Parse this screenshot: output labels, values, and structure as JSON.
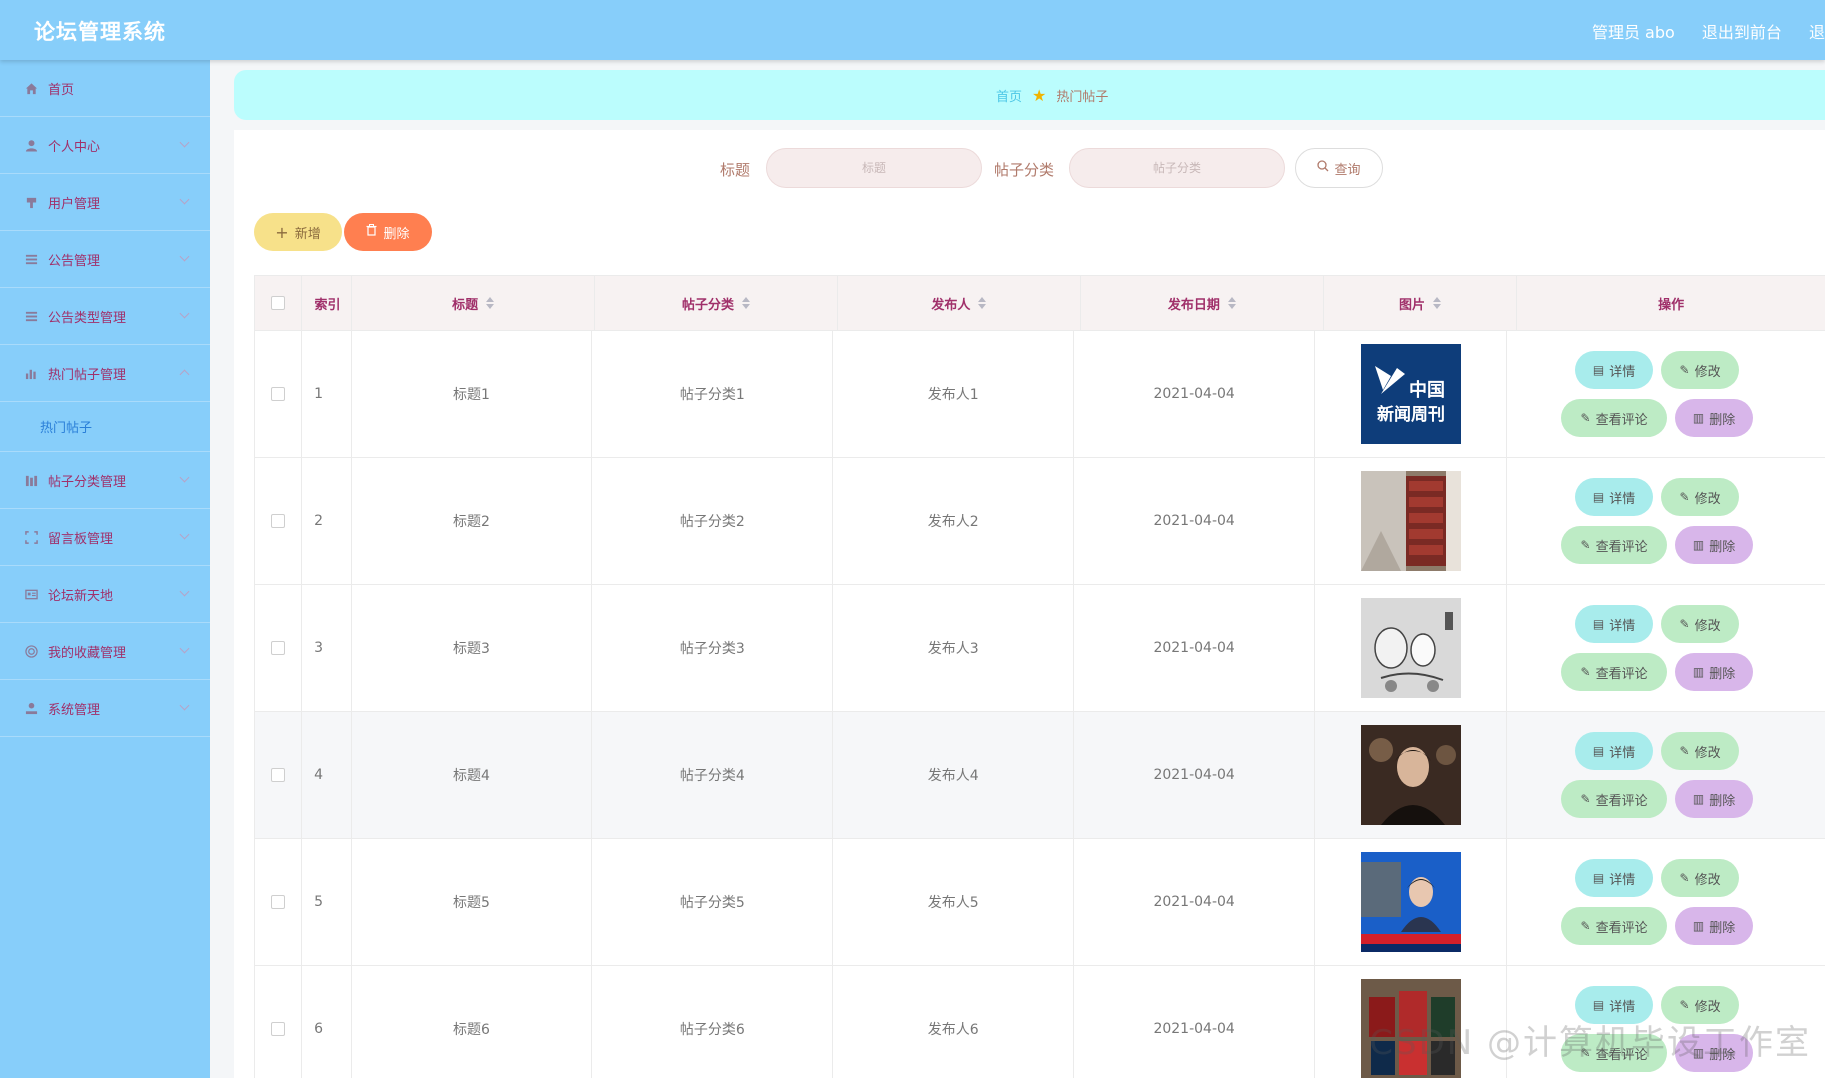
{
  "header": {
    "title": "论坛管理系统",
    "admin": "管理员 abo",
    "back_to_front": "退出到前台",
    "logout": "退"
  },
  "sidebar": {
    "items": [
      {
        "label": "首页",
        "icon": "home-icon"
      },
      {
        "label": "个人中心",
        "icon": "user-icon"
      },
      {
        "label": "用户管理",
        "icon": "users-icon"
      },
      {
        "label": "公告管理",
        "icon": "list-icon"
      },
      {
        "label": "公告类型管理",
        "icon": "list-icon"
      },
      {
        "label": "热门帖子管理",
        "icon": "chart-icon",
        "expanded": true,
        "sub": [
          "热门帖子"
        ]
      },
      {
        "label": "帖子分类管理",
        "icon": "bars-icon"
      },
      {
        "label": "留言板管理",
        "icon": "frame-icon"
      },
      {
        "label": "论坛新天地",
        "icon": "card-icon"
      },
      {
        "label": "我的收藏管理",
        "icon": "target-icon"
      },
      {
        "label": "系统管理",
        "icon": "person-icon"
      }
    ]
  },
  "breadcrumb": {
    "home": "首页",
    "current": "热门帖子"
  },
  "search": {
    "title_label": "标题",
    "title_placeholder": "标题",
    "category_label": "帖子分类",
    "category_placeholder": "帖子分类",
    "search_button": "查询"
  },
  "actions": {
    "add": "新增",
    "delete": "删除"
  },
  "table": {
    "columns": [
      "索引",
      "标题",
      "帖子分类",
      "发布人",
      "发布日期",
      "图片",
      "操作"
    ],
    "rows": [
      {
        "index": "1",
        "title": "标题1",
        "category": "帖子分类1",
        "author": "发布人1",
        "date": "2021-04-04",
        "image": "news-weekly-logo"
      },
      {
        "index": "2",
        "title": "标题2",
        "category": "帖子分类2",
        "author": "发布人2",
        "date": "2021-04-04",
        "image": "library-shelves"
      },
      {
        "index": "3",
        "title": "标题3",
        "category": "帖子分类3",
        "author": "发布人3",
        "date": "2021-04-04",
        "image": "cartoon-sketch"
      },
      {
        "index": "4",
        "title": "标题4",
        "category": "帖子分类4",
        "author": "发布人4",
        "date": "2021-04-04",
        "image": "portrait-photo"
      },
      {
        "index": "5",
        "title": "标题5",
        "category": "帖子分类5",
        "author": "发布人5",
        "date": "2021-04-04",
        "image": "news-broadcast"
      },
      {
        "index": "6",
        "title": "标题6",
        "category": "帖子分类6",
        "author": "发布人6",
        "date": "2021-04-04",
        "image": "passport-books"
      }
    ],
    "ops": {
      "detail": "详情",
      "edit": "修改",
      "comments": "查看评论",
      "remove": "删除"
    }
  },
  "thumb_texts": {
    "news_logo_line1": "中国",
    "news_logo_line2": "新闻周刊"
  },
  "watermark": "CSDN @计算机毕设工作室",
  "colors": {
    "header_bg": "#87cefa",
    "breadcrumb_bg": "#bbfdfd",
    "add_button": "#f7e18a",
    "delete_button": "#ff7f50",
    "detail_button": "#a8ecec",
    "edit_button": "#bdebc5",
    "remove_button": "#d8b6ea"
  }
}
